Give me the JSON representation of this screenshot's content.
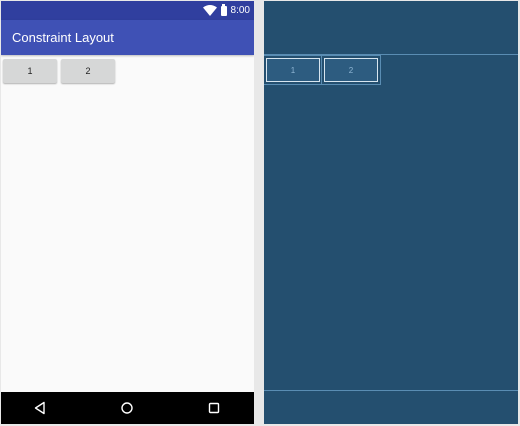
{
  "design": {
    "status_bar": {
      "time": "8:00"
    },
    "app_bar": {
      "title": "Constraint Layout"
    },
    "buttons": [
      {
        "label": "1"
      },
      {
        "label": "2"
      }
    ],
    "nav_bar": {
      "back_icon": "back-triangle-icon",
      "home_icon": "home-circle-icon",
      "recent_icon": "recent-square-icon"
    }
  },
  "blueprint": {
    "buttons": [
      {
        "label": "1"
      },
      {
        "label": "2"
      }
    ]
  },
  "colors": {
    "status_bar": "#303f9f",
    "app_bar": "#3f51b5",
    "button": "#d6d7d7",
    "blueprint_bg": "#244f6f",
    "blueprint_line": "#5a8db3"
  }
}
